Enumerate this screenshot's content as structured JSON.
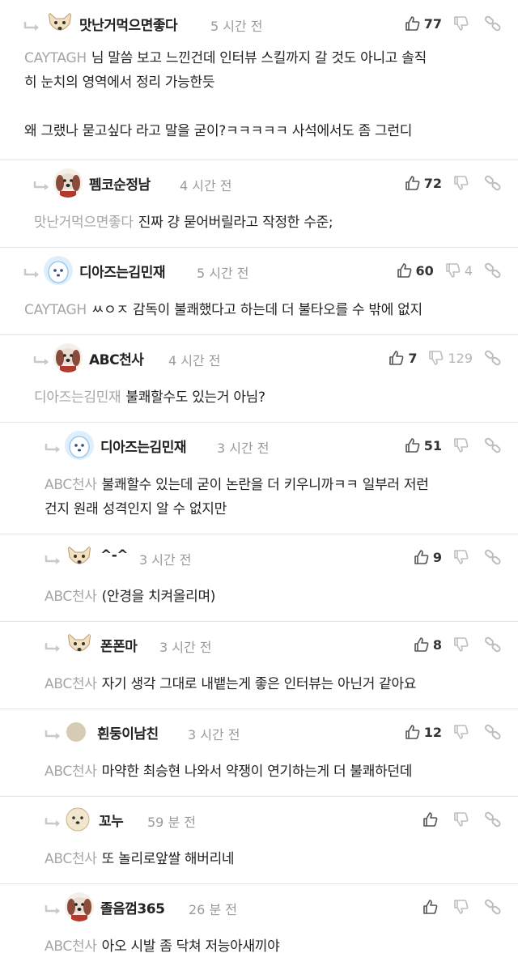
{
  "comments": [
    {
      "nick": "맛난거먹으면좋다",
      "time": "5 시간 전",
      "likes": "77",
      "dislikes": "",
      "mention": "CAYTAGH",
      "text": "님 말씀 보고 느낀건데 인터뷰 스킬까지 갈 것도 아니고 솔직\n히 눈치의 영역에서 정리 가능한듯\n\n왜 그랬나 묻고싶다 라고 말을 굳이?ㅋㅋㅋㅋㅋ 사석에서도 좀 그런디",
      "avatar": "dog-icon"
    },
    {
      "nick": "펨코순정남",
      "time": "4 시간 전",
      "likes": "72",
      "dislikes": "",
      "mention": "맛난거먹으면좋다",
      "text": "진짜 걍 묻어버릴라고 작정한 수준;",
      "avatar": "dog-icon"
    },
    {
      "nick": "디아즈는김민재",
      "time": "5 시간 전",
      "likes": "60",
      "dislikes": "4",
      "mention": "CAYTAGH",
      "text": "ㅆㅇㅈ 감독이 불쾌했다고 하는데 더 불타오를 수 밖에 없지",
      "avatar": "dog-icon"
    },
    {
      "nick": "ABC천사",
      "time": "4 시간 전",
      "likes": "7",
      "dislikes": "129",
      "mention": "디아즈는김민재",
      "text": "불쾌할수도 있는거 아님?",
      "avatar": "dog-icon"
    },
    {
      "nick": "디아즈는김민재",
      "time": "3 시간 전",
      "likes": "51",
      "dislikes": "",
      "mention": "ABC천사",
      "text": "불쾌할수 있는데 굳이 논란을 더 키우니까ㅋㅋ 일부러 저런\n건지 원래 성격인지 알 수 없지만",
      "avatar": "dog-icon"
    },
    {
      "nick": "^-^",
      "time": "3 시간 전",
      "likes": "9",
      "dislikes": "",
      "mention": "ABC천사",
      "text": "(안경을 치켜올리며)",
      "avatar": "dog-icon"
    },
    {
      "nick": "폰폰마",
      "time": "3 시간 전",
      "likes": "8",
      "dislikes": "",
      "mention": "ABC천사",
      "text": "자기 생각 그대로 내뱉는게 좋은 인터뷰는 아닌거 같아요",
      "avatar": "dog-icon"
    },
    {
      "nick": "흰둥이남친",
      "time": "3 시간 전",
      "likes": "12",
      "dislikes": "",
      "mention": "ABC천사",
      "text": "마약한 최승현 나와서 약쟁이 연기하는게 더 불쾌하던데",
      "avatar": "circle-icon"
    },
    {
      "nick": "꼬누",
      "time": "59 분 전",
      "likes": "",
      "dislikes": "",
      "mention": "ABC천사",
      "text": "또 놀리로앞쌀 해버리네",
      "avatar": "dog-icon"
    },
    {
      "nick": "졸음껌365",
      "time": "26 분 전",
      "likes": "",
      "dislikes": "",
      "mention": "ABC천사",
      "text": "아오 시발 좀 닥쳐 저능아새끼야",
      "avatar": "dog-icon"
    }
  ],
  "colors": {
    "text": "#222222",
    "muted": "#9a9a9a",
    "mention": "#a6a6a6",
    "divider": "#e3e3e3",
    "icon": "#555555",
    "icon_muted": "#bdbdbd"
  }
}
